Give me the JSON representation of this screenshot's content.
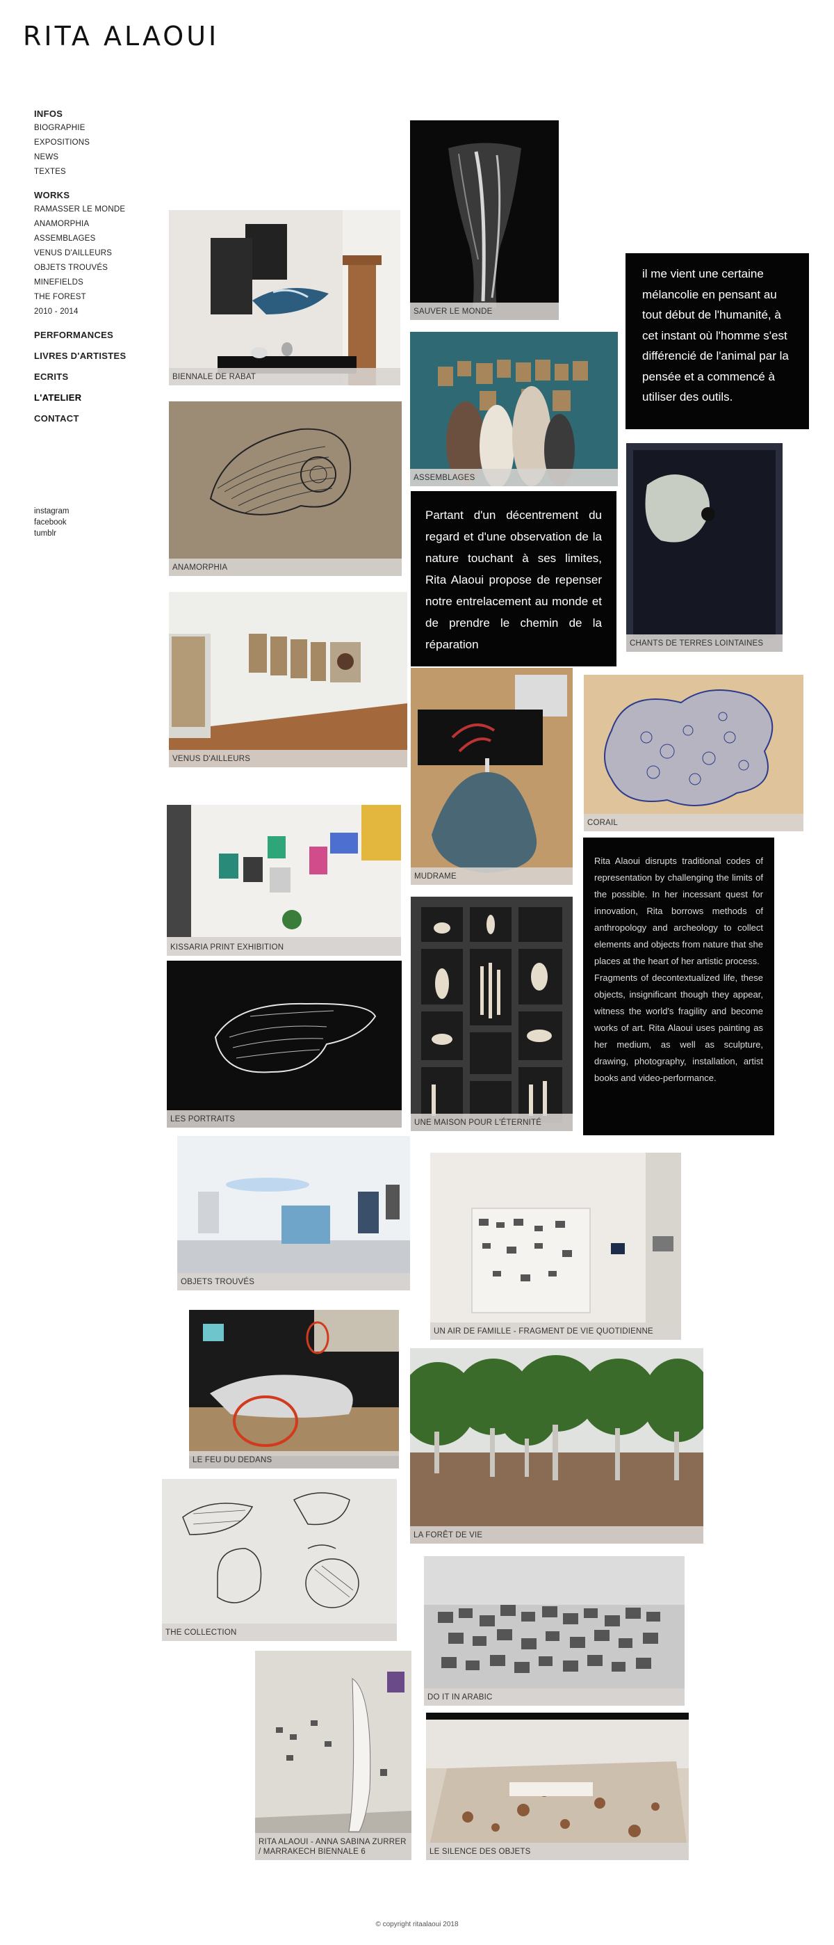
{
  "site": {
    "title": "RITA ALAOUI"
  },
  "nav": {
    "infos": {
      "label": "INFOS",
      "items": [
        "BIOGRAPHIE",
        "EXPOSITIONS",
        "NEWS",
        "TEXTES"
      ]
    },
    "works": {
      "label": "WORKS",
      "items": [
        "RAMASSER LE MONDE",
        "ANAMORPHIA",
        "ASSEMBLAGES",
        "VENUS D'AILLEURS",
        "OBJETS TROUVÉS",
        "MINEFIELDS",
        "THE FOREST",
        "2010 - 2014"
      ]
    },
    "performances": "PERFORMANCES",
    "livres": "LIVRES D'ARTISTES",
    "ecrits": "ECRITS",
    "atelier": "L'ATELIER",
    "contact": "CONTACT"
  },
  "social": [
    "instagram",
    "facebook",
    "tumblr"
  ],
  "tiles": [
    {
      "caption": "SAUVER LE MONDE"
    },
    {
      "caption": "BIENNALE DE RABAT"
    },
    {
      "caption": "ASSEMBLAGES"
    },
    {
      "caption": "ANAMORPHIA"
    },
    {
      "caption": "CHANTS DE TERRES LOINTAINES"
    },
    {
      "caption": "VENUS D'AILLEURS"
    },
    {
      "caption": "MUDRAME"
    },
    {
      "caption": "CORAIL"
    },
    {
      "caption": "KISSARIA PRINT EXHIBITION"
    },
    {
      "caption": "LES PORTRAITS"
    },
    {
      "caption": "UNE MAISON POUR L'ÉTERNITÉ"
    },
    {
      "caption": "OBJETS TROUVÉS"
    },
    {
      "caption": "UN AIR DE FAMILLE - FRAGMENT DE VIE QUOTIDIENNE"
    },
    {
      "caption": "LE FEU DU DEDANS"
    },
    {
      "caption": "LA FORÊT DE VIE"
    },
    {
      "caption": "THE COLLECTION"
    },
    {
      "caption": "DO IT IN ARABIC"
    },
    {
      "caption": "RITA ALAOUI - ANNA SABINA ZURRER / MARRAKECH BIENNALE 6"
    },
    {
      "caption": "LE SILENCE DES OBJETS"
    }
  ],
  "quotes": {
    "q1": "il me vient une certaine mélancolie en pensant au tout début de l'humanité, à cet instant où l'homme s'est différencié de l'animal par la pensée et a commencé à utiliser des outils.",
    "q2": "Partant d'un décentrement du regard et d'une observation de la nature touchant à ses limites, Rita Alaoui propose de repenser notre entrelacement au monde et de prendre le chemin de la réparation",
    "q3_p1": "Rita Alaoui disrupts traditional codes of representation by challenging the limits of the possible. In her incessant quest for innovation, Rita borrows methods of anthropology and archeology to collect elements and objects from nature that she places at the heart of her artistic process.",
    "q3_p2": "Fragments of decontextualized life, these objects, insignificant though they appear, witness the world's fragility and become works of art.  Rita Alaoui uses painting as her medium, as well as sculpture, drawing, photography, installation, artist books and video-performance."
  },
  "footer": "© copyright ritaalaoui 2018"
}
